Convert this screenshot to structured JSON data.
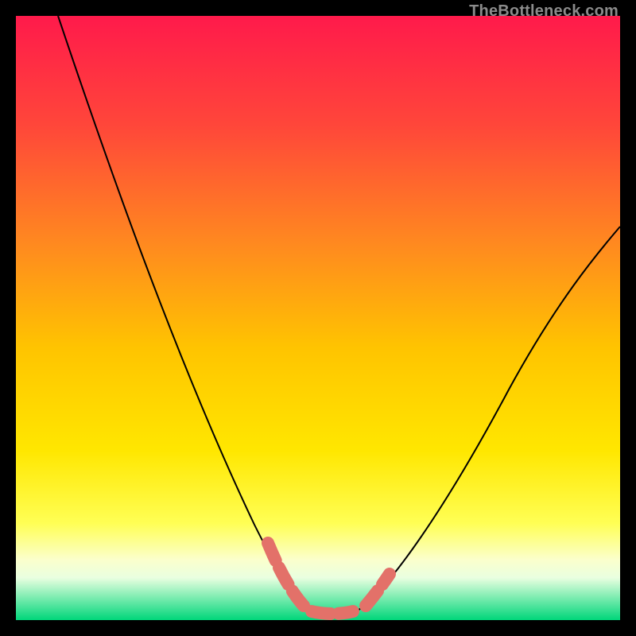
{
  "watermark": "TheBottleneck.com",
  "colors": {
    "gradient_top": "#ff1a4b",
    "gradient_mid1": "#ff7a22",
    "gradient_mid2": "#ffd400",
    "gradient_mid3": "#ffff4d",
    "gradient_mid4": "#f6ffd0",
    "gradient_bottom": "#00d67a",
    "curve": "#000000",
    "highlight": "#e37169",
    "frame": "#000000"
  },
  "chart_data": {
    "type": "line",
    "title": "",
    "xlabel": "",
    "ylabel": "",
    "xlim": [
      0,
      100
    ],
    "ylim": [
      0,
      100
    ],
    "grid": false,
    "legend": false,
    "series": [
      {
        "name": "bottleneck-curve",
        "x": [
          7,
          12,
          18,
          25,
          32,
          38,
          42,
          45,
          48,
          50,
          52,
          55,
          60,
          66,
          74,
          82,
          90,
          100
        ],
        "y": [
          100,
          88,
          75,
          60,
          44,
          28,
          16,
          7,
          2,
          1,
          1,
          2,
          5,
          12,
          25,
          38,
          50,
          65
        ]
      }
    ],
    "annotations": [
      {
        "name": "sweet-spot-highlight",
        "type": "dashed-segment",
        "x_range": [
          43,
          58
        ],
        "y_range": [
          0,
          8
        ],
        "color": "#e37169"
      }
    ]
  }
}
